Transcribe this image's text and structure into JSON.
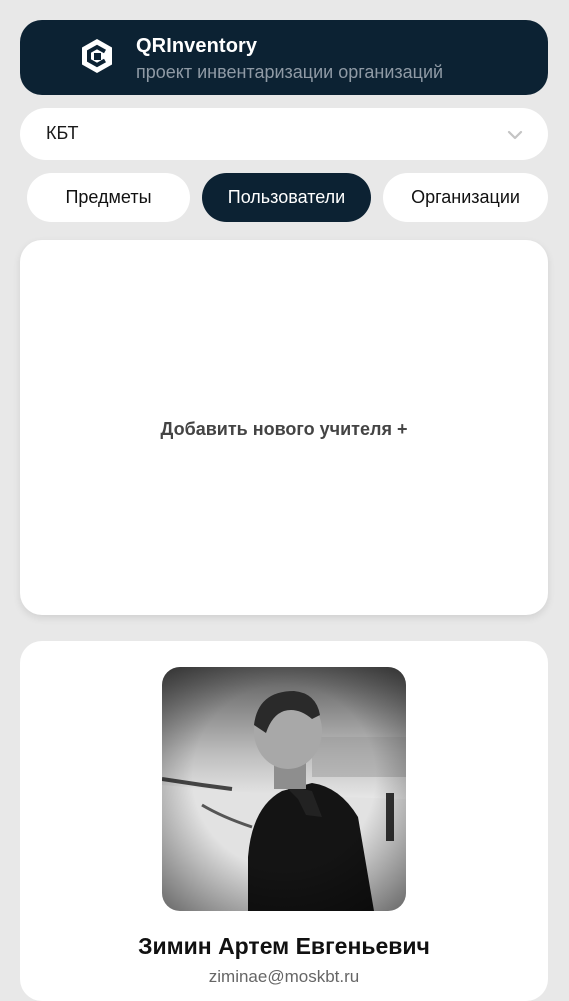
{
  "header": {
    "title": "QRInventory",
    "subtitle": "проект инвентаризации организаций",
    "logo_icon": "qr-inventory-logo-icon",
    "background": "#0c2233"
  },
  "organization_select": {
    "value": "КБТ",
    "icon": "chevron-down-icon"
  },
  "tabs": [
    {
      "label": "Предметы",
      "active": false
    },
    {
      "label": "Пользователи",
      "active": true
    },
    {
      "label": "Организации",
      "active": false
    }
  ],
  "add_card": {
    "label": "Добавить нового учителя +"
  },
  "users": [
    {
      "name": "Зимин Артем Евгеньевич",
      "email": "ziminae@moskbt.ru"
    }
  ],
  "colors": {
    "accent": "#0c2233",
    "page_background": "#e8e8e8",
    "card": "#ffffff"
  }
}
